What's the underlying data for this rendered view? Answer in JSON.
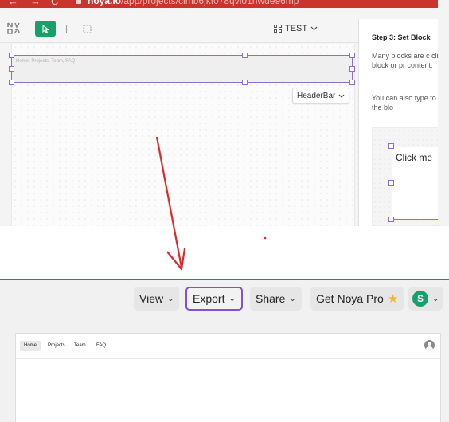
{
  "browser": {
    "back": "←",
    "forward": "→",
    "reload": "C",
    "url_domain": "noya.io",
    "url_path": "/app/projects/clmb6jkt078qvlo1nwde96mp"
  },
  "editor": {
    "test_label": "TEST",
    "header_placeholder": "Home, Projects, Team, FAQ",
    "headerbar_label": "HeaderBar"
  },
  "side_panel": {
    "step_title": "Step 3: Set Block",
    "para1": "Many blocks are c click a block or pr content.",
    "para2": "You can also type to change the blo",
    "click_label": "Click me"
  },
  "toolbar": {
    "view_label": "View",
    "export_label": "Export",
    "share_label": "Share",
    "pro_label": "Get Noya Pro",
    "avatar_letter": "S"
  },
  "preview": {
    "nav_items": [
      "Home",
      "Projects",
      "Team",
      "FAQ"
    ]
  },
  "colors": {
    "accent_green": "#17a06a",
    "selection_purple": "#8b6cd9",
    "annotation_red": "#cf3b3b",
    "star_yellow": "#f2b824"
  },
  "icons": {
    "logo": "noya-logo-icon",
    "pointer": "pointer-icon",
    "add": "plus-icon",
    "select": "dashed-rect-icon",
    "grid": "grid-icon",
    "star": "star-icon",
    "user": "user-icon"
  }
}
